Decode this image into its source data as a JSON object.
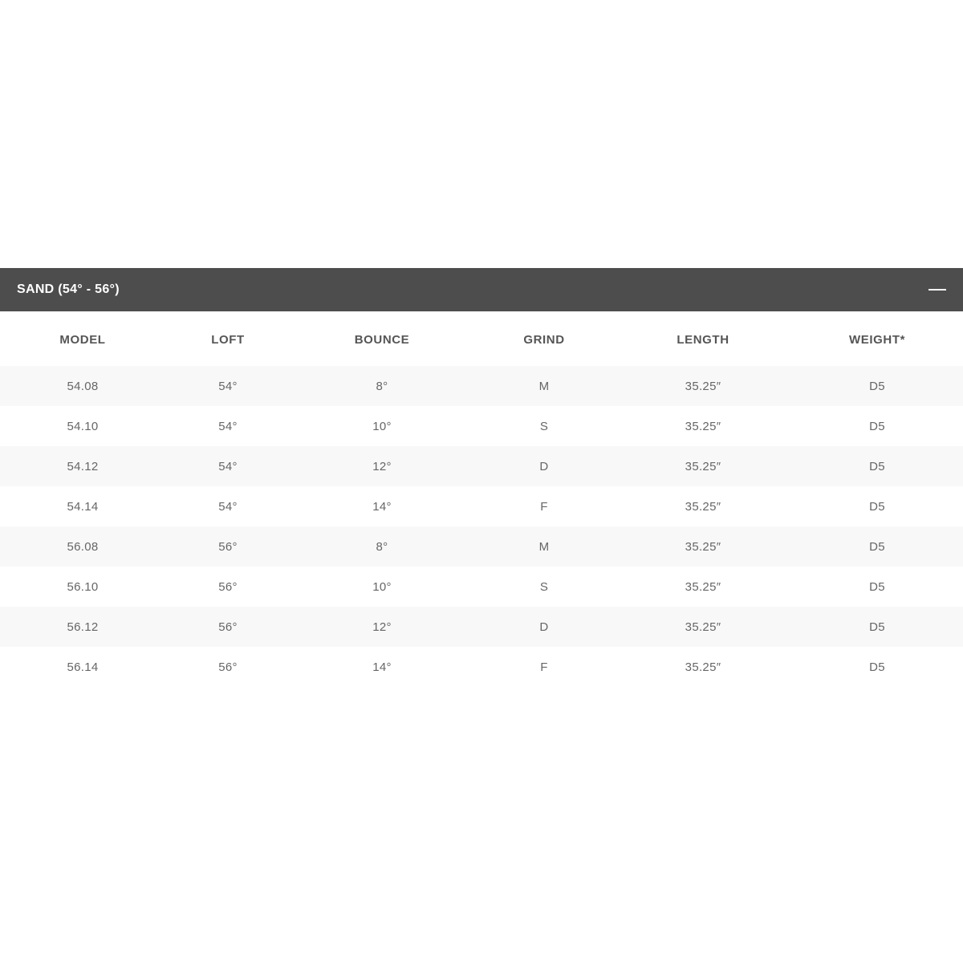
{
  "section": {
    "title": "SAND (54° - 56°)",
    "toggle_icon": "minus-icon"
  },
  "table": {
    "headers": [
      "MODEL",
      "LOFT",
      "BOUNCE",
      "GRIND",
      "LENGTH",
      "WEIGHT*"
    ],
    "rows": [
      [
        "54.08",
        "54°",
        "8°",
        "M",
        "35.25″",
        "D5"
      ],
      [
        "54.10",
        "54°",
        "10°",
        "S",
        "35.25″",
        "D5"
      ],
      [
        "54.12",
        "54°",
        "12°",
        "D",
        "35.25″",
        "D5"
      ],
      [
        "54.14",
        "54°",
        "14°",
        "F",
        "35.25″",
        "D5"
      ],
      [
        "56.08",
        "56°",
        "8°",
        "M",
        "35.25″",
        "D5"
      ],
      [
        "56.10",
        "56°",
        "10°",
        "S",
        "35.25″",
        "D5"
      ],
      [
        "56.12",
        "56°",
        "12°",
        "D",
        "35.25″",
        "D5"
      ],
      [
        "56.14",
        "56°",
        "14°",
        "F",
        "35.25″",
        "D5"
      ]
    ]
  },
  "colors": {
    "header_bg": "#4d4d4d",
    "header_text": "#ffffff",
    "stripe_row": "#f8f8f8",
    "cell_text": "#666666"
  }
}
